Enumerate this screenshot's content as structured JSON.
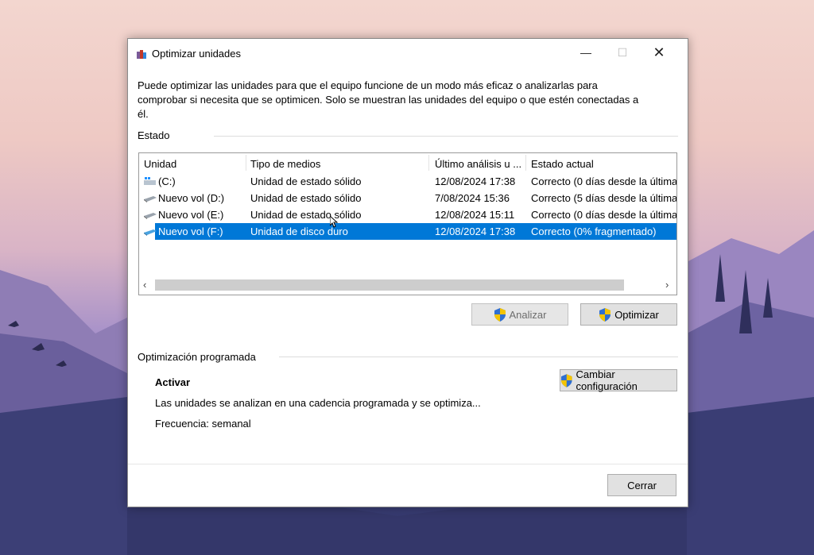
{
  "window": {
    "title": "Optimizar unidades",
    "description": "Puede optimizar las unidades para que el equipo funcione de un modo más eficaz o analizarlas para comprobar si necesita que se optimicen. Solo se muestran las unidades del equipo o que estén conectadas a él."
  },
  "status_section": {
    "label": "Estado",
    "columns": [
      "Unidad",
      "Tipo de medios",
      "Último análisis u ...",
      "Estado actual"
    ],
    "drives": [
      {
        "name": "(C:)",
        "media": "Unidad de estado sólido",
        "last": "12/08/2024 17:38",
        "state": "Correcto (0 días desde la última",
        "icon": "system-drive-icon"
      },
      {
        "name": "Nuevo vol (D:)",
        "media": "Unidad de estado sólido",
        "last": "7/08/2024 15:36",
        "state": "Correcto (5 días desde la última",
        "icon": "drive-icon"
      },
      {
        "name": "Nuevo vol (E:)",
        "media": "Unidad de estado sólido",
        "last": "12/08/2024 15:11",
        "state": "Correcto (0 días desde la última",
        "icon": "drive-icon"
      },
      {
        "name": "Nuevo vol (F:)",
        "media": "Unidad de disco duro",
        "last": "12/08/2024 17:38",
        "state": "Correcto (0% fragmentado)",
        "icon": "hdd-icon",
        "selected": true
      }
    ]
  },
  "actions": {
    "analyze_label": "Analizar",
    "optimize_label": "Optimizar"
  },
  "schedule": {
    "label": "Optimización programada",
    "status": "Activar",
    "description": "Las unidades se analizan en una cadencia programada y se optimiza...",
    "frequency": "Frecuencia: semanal",
    "change_label": "Cambiar configuración"
  },
  "footer": {
    "close_label": "Cerrar"
  },
  "colors": {
    "selection": "#0078d7",
    "shield_blue": "#2f6fd1",
    "shield_yellow": "#f4c400"
  }
}
